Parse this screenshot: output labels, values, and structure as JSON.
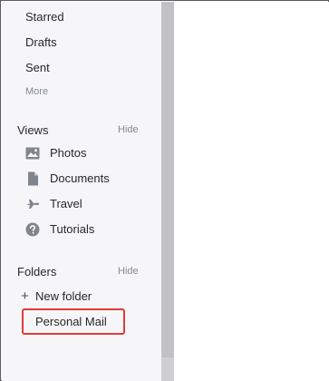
{
  "sidebar": {
    "mail_items": [
      {
        "label": "Starred"
      },
      {
        "label": "Drafts"
      },
      {
        "label": "Sent"
      }
    ],
    "more_label": "More",
    "views": {
      "title": "Views",
      "hide_label": "Hide",
      "items": [
        {
          "label": "Photos",
          "icon": "photo-icon"
        },
        {
          "label": "Documents",
          "icon": "document-icon"
        },
        {
          "label": "Travel",
          "icon": "airplane-icon"
        },
        {
          "label": "Tutorials",
          "icon": "help-icon"
        }
      ]
    },
    "folders": {
      "title": "Folders",
      "hide_label": "Hide",
      "new_folder_label": "New folder",
      "items": [
        {
          "label": "Personal Mail",
          "highlighted": true
        }
      ]
    }
  },
  "colors": {
    "sidebar_bg": "#f6f6f8",
    "icon": "#7e858d",
    "highlight_border": "#e23b3b",
    "muted_text": "#828a93"
  }
}
